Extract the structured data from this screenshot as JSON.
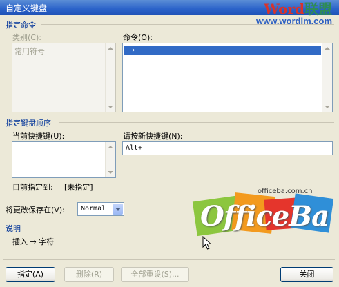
{
  "window": {
    "title": "自定义键盘"
  },
  "watermark": {
    "brand_a": "Word",
    "brand_b": "联盟",
    "url": "www.wordlm.com"
  },
  "section_command": "指定命令",
  "categories": {
    "label": "类别(C):",
    "items": [
      "常用符号"
    ]
  },
  "commands": {
    "label": "命令(O):",
    "items": [
      "→"
    ]
  },
  "section_keys": "指定键盘顺序",
  "current_keys": {
    "label": "当前快捷键(U):"
  },
  "new_key": {
    "label": "请按新快捷键(N):",
    "value": "Alt+"
  },
  "assigned_to": {
    "label": "目前指定到:",
    "value": "[未指定]"
  },
  "save_in": {
    "label": "将更改保存在(V):",
    "value": "Normal"
  },
  "section_desc": "说明",
  "description": "插入 → 字符",
  "logo": {
    "domain": "officeba.com.cn",
    "text": "OfficeBa"
  },
  "buttons": {
    "assign": "指定(A)",
    "remove": "删除(R)",
    "reset_all": "全部重设(S)...",
    "close": "关闭"
  }
}
